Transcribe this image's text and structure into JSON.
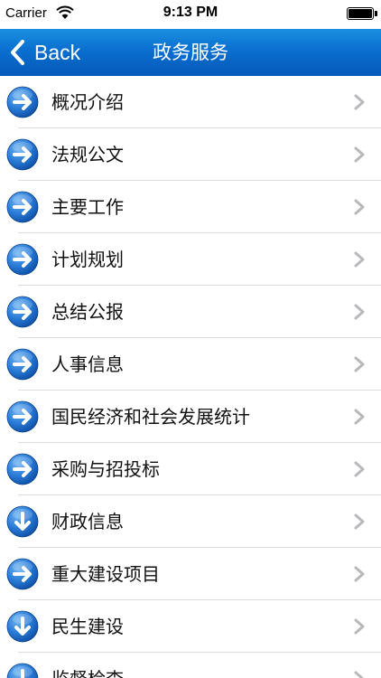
{
  "status_bar": {
    "carrier": "Carrier",
    "time": "9:13 PM"
  },
  "nav": {
    "back_label": "Back",
    "title": "政务服务"
  },
  "colors": {
    "nav_top": "#1a8fe0",
    "nav_bottom": "#0659b8",
    "icon_blue": "#1e6fd0"
  },
  "items": [
    {
      "label": "概况介绍",
      "icon": "arrow-right-icon"
    },
    {
      "label": "法规公文",
      "icon": "arrow-right-icon"
    },
    {
      "label": "主要工作",
      "icon": "arrow-right-icon"
    },
    {
      "label": "计划规划",
      "icon": "arrow-right-icon"
    },
    {
      "label": "总结公报",
      "icon": "arrow-right-icon"
    },
    {
      "label": "人事信息",
      "icon": "arrow-right-icon"
    },
    {
      "label": "国民经济和社会发展统计",
      "icon": "arrow-right-icon"
    },
    {
      "label": "采购与招投标",
      "icon": "arrow-right-icon"
    },
    {
      "label": "财政信息",
      "icon": "arrow-down-icon"
    },
    {
      "label": "重大建设项目",
      "icon": "arrow-right-icon"
    },
    {
      "label": "民生建设",
      "icon": "arrow-down-icon"
    },
    {
      "label": "监督检查",
      "icon": "arrow-down-icon"
    }
  ]
}
